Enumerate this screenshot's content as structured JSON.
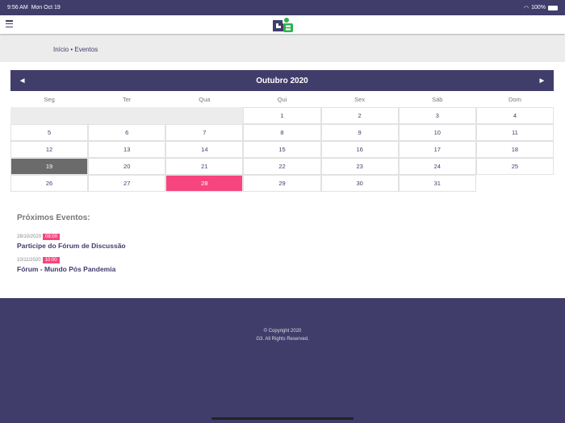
{
  "status": {
    "time": "9:56 AM",
    "date": "Mon Oct 19",
    "battery": "100%"
  },
  "logo": {
    "text": "G3"
  },
  "breadcrumb": {
    "home": "Início",
    "sep": " • ",
    "current": "Eventos"
  },
  "calendar": {
    "title": "Outubro 2020",
    "prev": "◀",
    "next": "▶",
    "weekdays": [
      "Seg",
      "Ter",
      "Qua",
      "Qui",
      "Sex",
      "Sáb",
      "Dom"
    ],
    "leading_empty": 3,
    "days": 31,
    "today": 19,
    "selected": 28
  },
  "events": {
    "heading": "Próximos Eventos:",
    "items": [
      {
        "date": "28/10/2020",
        "time": "08:00",
        "title": "Participe do Fórum de Discussão"
      },
      {
        "date": "10/11/2020",
        "time": "10:00",
        "title": "Fórum - Mundo Pós Pandemia"
      }
    ]
  },
  "footer": {
    "line1": "© Copyright 2020",
    "line2": "G3. All Rights Reserved."
  },
  "colors": {
    "primary": "#403d6b",
    "accent": "#f7457f",
    "today": "#6b6b6b",
    "logo_green": "#2db34a"
  }
}
